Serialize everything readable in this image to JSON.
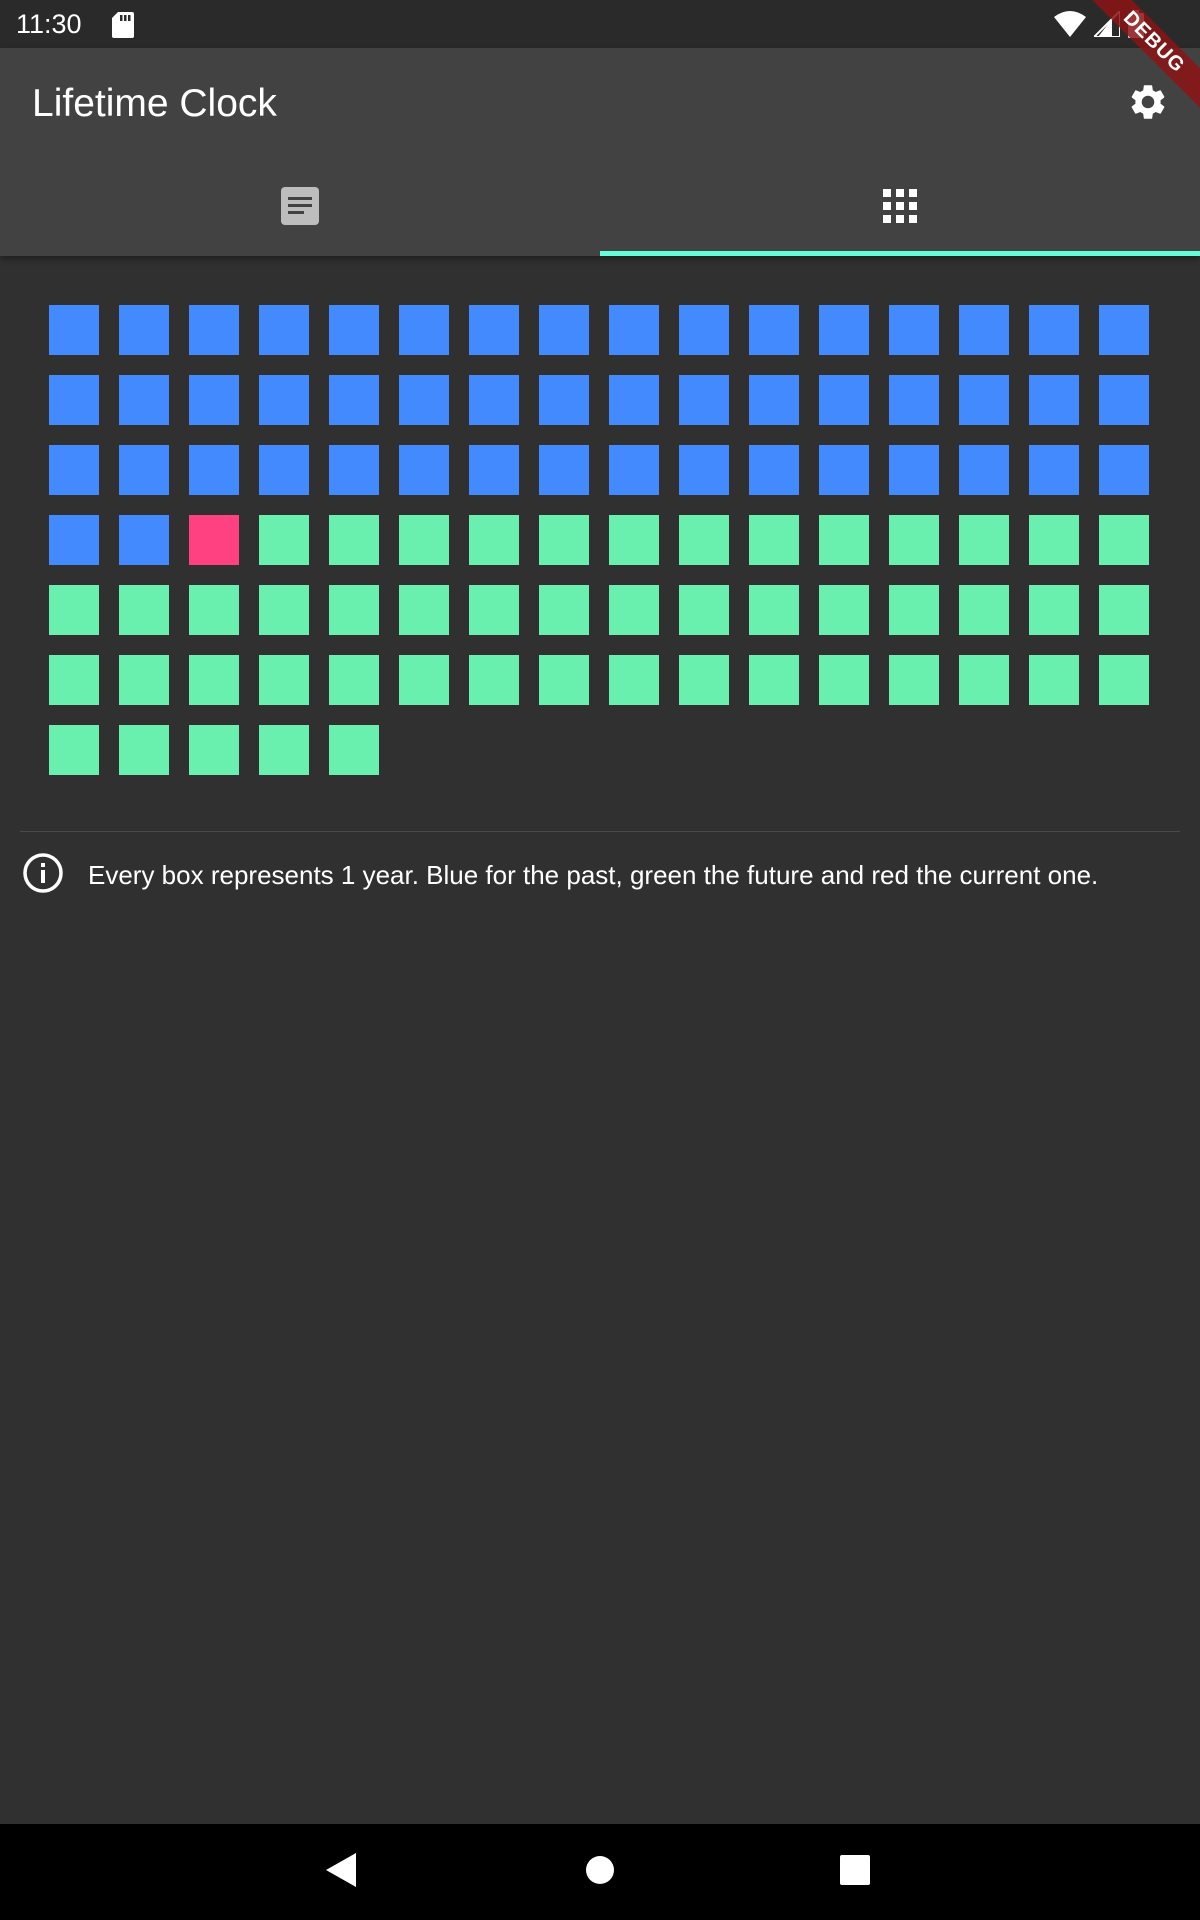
{
  "status_bar": {
    "time": "11:30",
    "icons": [
      "sd-card-icon",
      "wifi-icon",
      "signal-icon",
      "battery-icon"
    ]
  },
  "app_bar": {
    "title": "Lifetime Clock",
    "settings_icon": "gear-icon"
  },
  "debug_banner": "DEBUG",
  "tabs": [
    {
      "icon": "article-icon",
      "selected": false
    },
    {
      "icon": "grid-icon",
      "selected": true
    }
  ],
  "colors": {
    "past": "#448AFF",
    "current": "#FF4081",
    "future": "#69F0AE",
    "indicator": "#64FFDA",
    "background": "#303030",
    "app_bar": "#424242"
  },
  "lifetime_grid": {
    "total_years": 101,
    "past_years": 50,
    "current_year_index": 51,
    "columns": 16
  },
  "info": {
    "icon": "info-icon",
    "text": "Every box represents 1 year. Blue for the past, green the future and red the current one."
  },
  "nav_bar": {
    "buttons": [
      "back-icon",
      "home-icon",
      "recents-icon"
    ]
  }
}
